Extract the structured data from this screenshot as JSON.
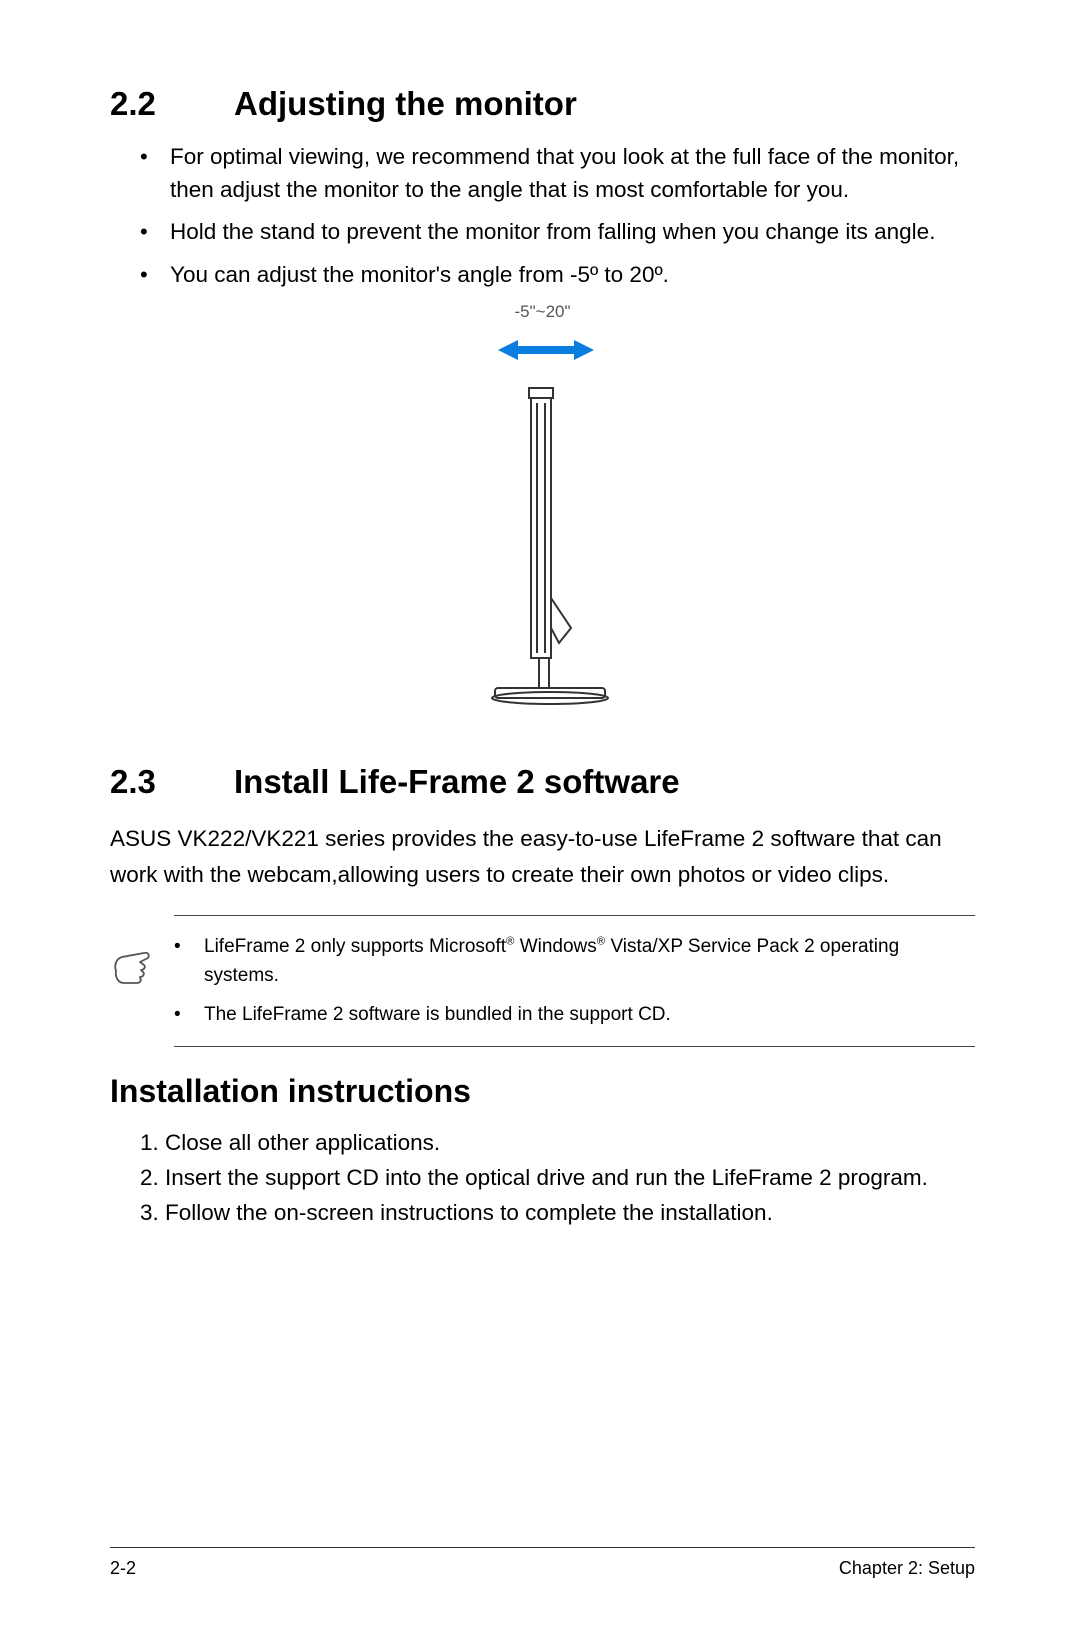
{
  "section22": {
    "number": "2.2",
    "title": "Adjusting the monitor",
    "bullets": [
      "For optimal viewing, we recommend that you look at the full face of the monitor, then adjust the monitor to the angle that is most comfortable for you.",
      "Hold the stand to prevent the monitor from falling when you change its angle.",
      "You can adjust the monitor's angle from  -5º to 20º."
    ],
    "diagram_label": "-5\"~20\""
  },
  "section23": {
    "number": "2.3",
    "title": "Install Life-Frame 2 software",
    "body": "ASUS VK222/VK221 series provides the easy-to-use LifeFrame 2 software that can work with the webcam,allowing users to create their own photos or video clips.",
    "notes": {
      "n1_pre": "LifeFrame 2 only supports Microsoft",
      "n1_mid": " Windows",
      "n1_post": " Vista/XP Service Pack 2 operating systems.",
      "reg": "®",
      "n2": "The LifeFrame 2 software is bundled in the support CD."
    },
    "install_heading": "Installation instructions",
    "steps": [
      "1. Close all other applications.",
      "2. Insert the support CD into the optical drive and run the LifeFrame 2 program.",
      "3. Follow the on-screen instructions to complete the installation."
    ]
  },
  "footer": {
    "left": "2-2",
    "right": "Chapter 2: Setup"
  }
}
